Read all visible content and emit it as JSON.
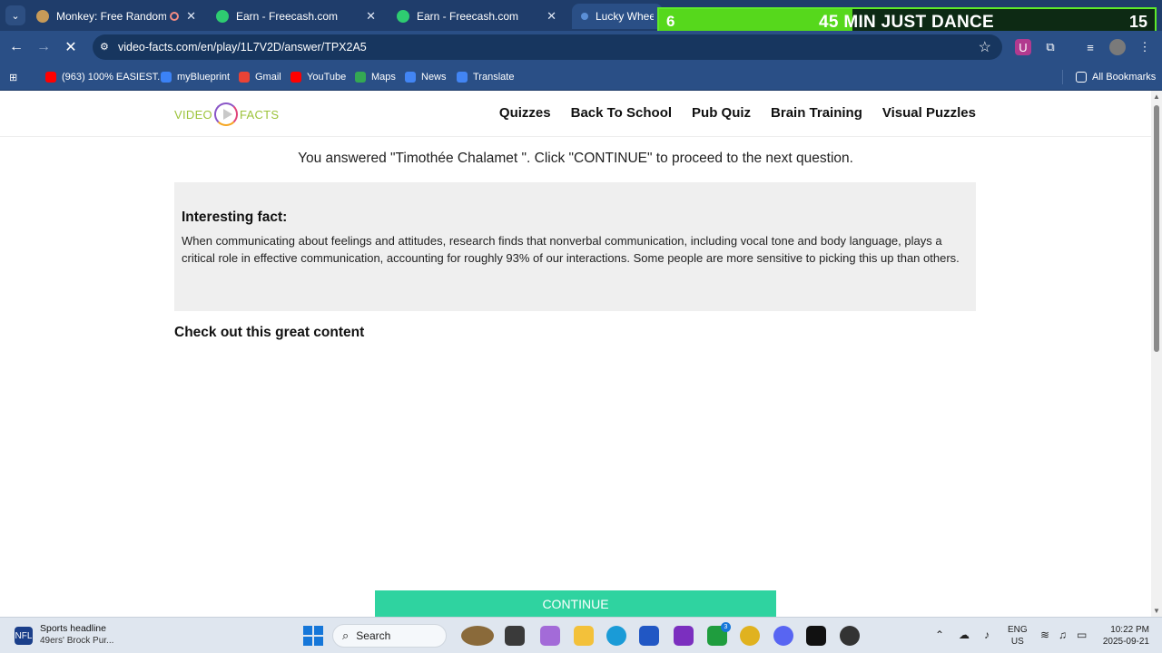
{
  "browser": {
    "tabs": [
      {
        "title": "Monkey: Free Random Vide",
        "favicon_color": "#c79a58",
        "active": false
      },
      {
        "title": "Earn - Freecash.com",
        "favicon_color": "#2ecc71",
        "active": false
      },
      {
        "title": "Earn - Freecash.com",
        "favicon_color": "#2ecc71",
        "active": false
      },
      {
        "title": "Lucky Wheel",
        "favicon_color": "#5b8fd6",
        "active": true
      }
    ],
    "overlay": {
      "left_number": "6",
      "text": "45 MIN JUST DANCE",
      "right_number": "15",
      "progress": 0.39
    },
    "url": "video-facts.com/en/play/1L7V2D/answer/TPX2A5",
    "bookmarks": [
      {
        "label": "(963) 100% EASIEST...",
        "icon": "youtube-icon",
        "color": "#ff0000"
      },
      {
        "label": "myBlueprint",
        "icon": "myblueprint-icon",
        "color": "#3b82f6"
      },
      {
        "label": "Gmail",
        "icon": "gmail-icon",
        "color": "#ea4335"
      },
      {
        "label": "YouTube",
        "icon": "youtube-icon",
        "color": "#ff0000"
      },
      {
        "label": "Maps",
        "icon": "maps-icon",
        "color": "#34a853"
      },
      {
        "label": "News",
        "icon": "news-icon",
        "color": "#4285f4"
      },
      {
        "label": "Translate",
        "icon": "translate-icon",
        "color": "#4285f4"
      }
    ],
    "all_bookmarks": "All Bookmarks"
  },
  "site": {
    "logo_left": "VIDEO",
    "logo_right": "FACTS",
    "nav": [
      "Quizzes",
      "Back To School",
      "Pub Quiz",
      "Brain Training",
      "Visual Puzzles"
    ],
    "answer_line": "You answered \"Timothée Chalamet \". Click \"CONTINUE\" to proceed to the next question.",
    "fact_heading": "Interesting fact:",
    "fact_body": "When communicating about feelings and attitudes, research finds that nonverbal communication, including vocal tone and body language, plays a critical role in effective communication, accounting for roughly 93% of our interactions. Some people are more sensitive to picking this up than others.",
    "content_heading": "Check out this great content",
    "continue_label": "CONTINUE",
    "accent_color": "#2fd3a0"
  },
  "taskbar": {
    "news_title": "Sports headline",
    "news_subtitle": "49ers' Brock Pur...",
    "search_label": "Search",
    "xbox_badge": "3",
    "lang_line1": "ENG",
    "lang_line2": "US",
    "time": "10:22 PM",
    "date": "2025-09-21"
  }
}
